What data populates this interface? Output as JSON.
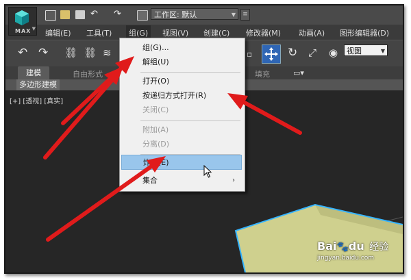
{
  "app": {
    "logo_text": "MAX"
  },
  "workspace": {
    "label": "工作区: 默认"
  },
  "menubar": {
    "items": [
      "编辑(E)",
      "工具(T)",
      "组(G)",
      "视图(V)",
      "创建(C)",
      "修改器(M)",
      "动画(A)",
      "图形编辑器(D)"
    ]
  },
  "toolbar": {
    "view_select": "视图"
  },
  "ribbon": {
    "tabs": [
      "建模",
      "自由形式",
      "填充"
    ],
    "subtab": "多边形建模"
  },
  "viewport": {
    "label": "[+] [透视] [真实]"
  },
  "context_menu": {
    "items": [
      {
        "label": "组(G)...",
        "enabled": true
      },
      {
        "label": "解组(U)",
        "enabled": true
      },
      {
        "label": "打开(O)",
        "enabled": true
      },
      {
        "label": "按递归方式打开(R)",
        "enabled": true
      },
      {
        "label": "关闭(C)",
        "enabled": false
      },
      {
        "label": "附加(A)",
        "enabled": false
      },
      {
        "label": "分离(D)",
        "enabled": false
      },
      {
        "label": "炸开(E)",
        "enabled": true,
        "highlighted": true
      },
      {
        "label": "集合",
        "enabled": true,
        "submenu": true
      }
    ]
  },
  "watermark": {
    "brand": "Bai",
    "brand2": "du",
    "suffix": "经验",
    "url": "jingyan.baidu.com"
  },
  "colors": {
    "accent_highlight": "#99c6ec",
    "arrow": "#e01b1b",
    "object": "#cfd08e",
    "selection_edge": "#35b4ff"
  }
}
